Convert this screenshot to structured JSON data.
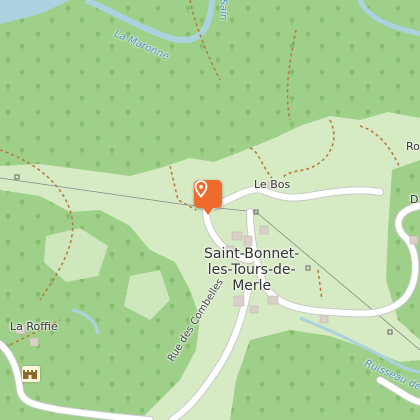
{
  "map": {
    "places": {
      "saint_bonnet": [
        "Saint-Bonnet-",
        "les-Tours-de-",
        "Merle"
      ],
      "le_bos": "Le Bos",
      "la_roffie": "La Roffie",
      "ro_partial": "Ro",
      "d_partial": "D"
    },
    "waterways": {
      "la_maronne": "La Maronne",
      "ruisseau": "Ruisseau de T",
      "saint_partial": "Sain"
    },
    "roads": {
      "rue_des_combelles": "Rue des Combelles"
    },
    "marker": {
      "icon": "map-pin-icon",
      "color": "#ee6b2b"
    },
    "poi_icons": [
      "castle-icon"
    ],
    "colors": {
      "forest": "#9fd08a",
      "meadow": "#d6ebc4",
      "water": "#aad3df",
      "road": "#ffffff",
      "path": "#b87a3a",
      "marker": "#ee6b2b"
    }
  }
}
